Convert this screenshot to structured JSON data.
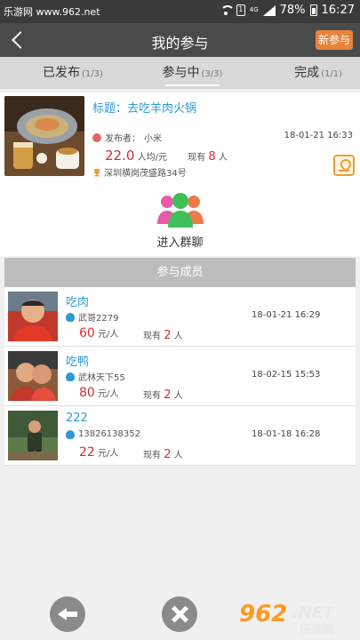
{
  "statusbar": {
    "watermark": "乐游网 www.962.net",
    "sim": "1",
    "network": "4G",
    "battery": "78%",
    "time": "16:27"
  },
  "header": {
    "title": "我的参与",
    "new_button": "新参与"
  },
  "tabs": [
    {
      "label": "已发布",
      "count": "(1/3)",
      "active": false
    },
    {
      "label": "参与中",
      "count": "(3/3)",
      "active": true
    },
    {
      "label": "完成",
      "count": "(1/1)",
      "active": false
    }
  ],
  "activity": {
    "title": "标题：去吃羊肉火锅",
    "publisher_label": "发布者：",
    "publisher": "小米",
    "date": "18-01-21 16:33",
    "price": "22.0",
    "price_unit": "人均/元",
    "existing_label": "现有",
    "existing_count": "8",
    "existing_unit": "人",
    "address": "深圳横岗茂盛路34号"
  },
  "group_chat": {
    "label": "进入群聊"
  },
  "members": {
    "heading": "参与成员",
    "items": [
      {
        "name": "吃肉",
        "user": "武哥2279",
        "date": "18-01-21 16:29",
        "price": "60",
        "unit": "元/人",
        "existing_label": "现有",
        "count": "2",
        "count_unit": "人"
      },
      {
        "name": "吃鸭",
        "user": "武林天下55",
        "date": "18-02-15 15:53",
        "price": "80",
        "unit": "元/人",
        "existing_label": "现有",
        "count": "2",
        "count_unit": "人"
      },
      {
        "name": "222",
        "user": "13826138352",
        "date": "18-01-18 16:28",
        "price": "22",
        "unit": "元/人",
        "existing_label": "现有",
        "count": "2",
        "count_unit": "人"
      }
    ]
  },
  "brand": {
    "number": "962",
    "suffix": ".NET",
    "name": "乐游网"
  },
  "colors": {
    "header": "#4a4a4a",
    "accent": "#e8833a",
    "link": "#2e9bd4",
    "price": "#d32f2f"
  }
}
